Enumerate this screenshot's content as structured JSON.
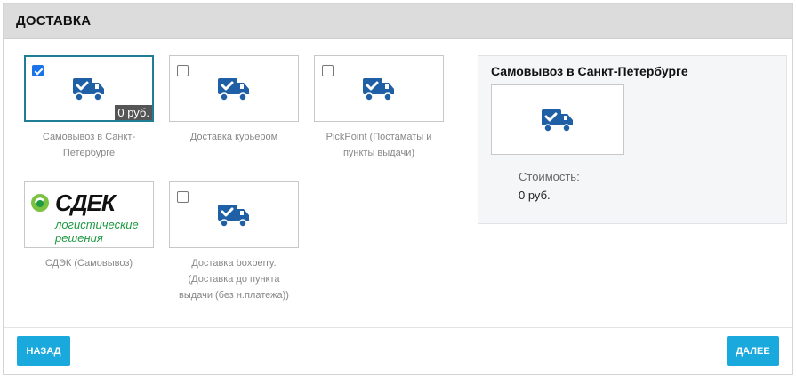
{
  "header": {
    "title": "ДОСТАВКА"
  },
  "options": [
    {
      "label": "Самовывоз в Санкт-Петербурге",
      "price": "0 руб.",
      "selected": true,
      "icon": "truck-check-icon"
    },
    {
      "label": "Доставка курьером",
      "selected": false,
      "icon": "truck-check-icon"
    },
    {
      "label": "PickPoint (Постаматы и пункты выдачи)",
      "selected": false,
      "icon": "truck-check-icon"
    },
    {
      "label": "СДЭК (Самовывоз)",
      "selected": false,
      "icon": "cdek-logo",
      "logo_text": "СДЕК",
      "logo_sub": "логистические решения"
    },
    {
      "label": "Доставка boxberry. (Доставка до пункта выдачи (без н.платежа))",
      "selected": false,
      "icon": "truck-check-icon"
    }
  ],
  "summary": {
    "title": "Самовывоз в Санкт-Петербурге",
    "cost_label": "Стоимость:",
    "cost_value": "0 руб."
  },
  "buttons": {
    "back": "НАЗАД",
    "next": "ДАЛЕЕ"
  },
  "colors": {
    "accent": "#19a9dd",
    "icon": "#1f5fa6",
    "selected_border": "#1f7d96",
    "cdek_green": "#1e9a40"
  }
}
